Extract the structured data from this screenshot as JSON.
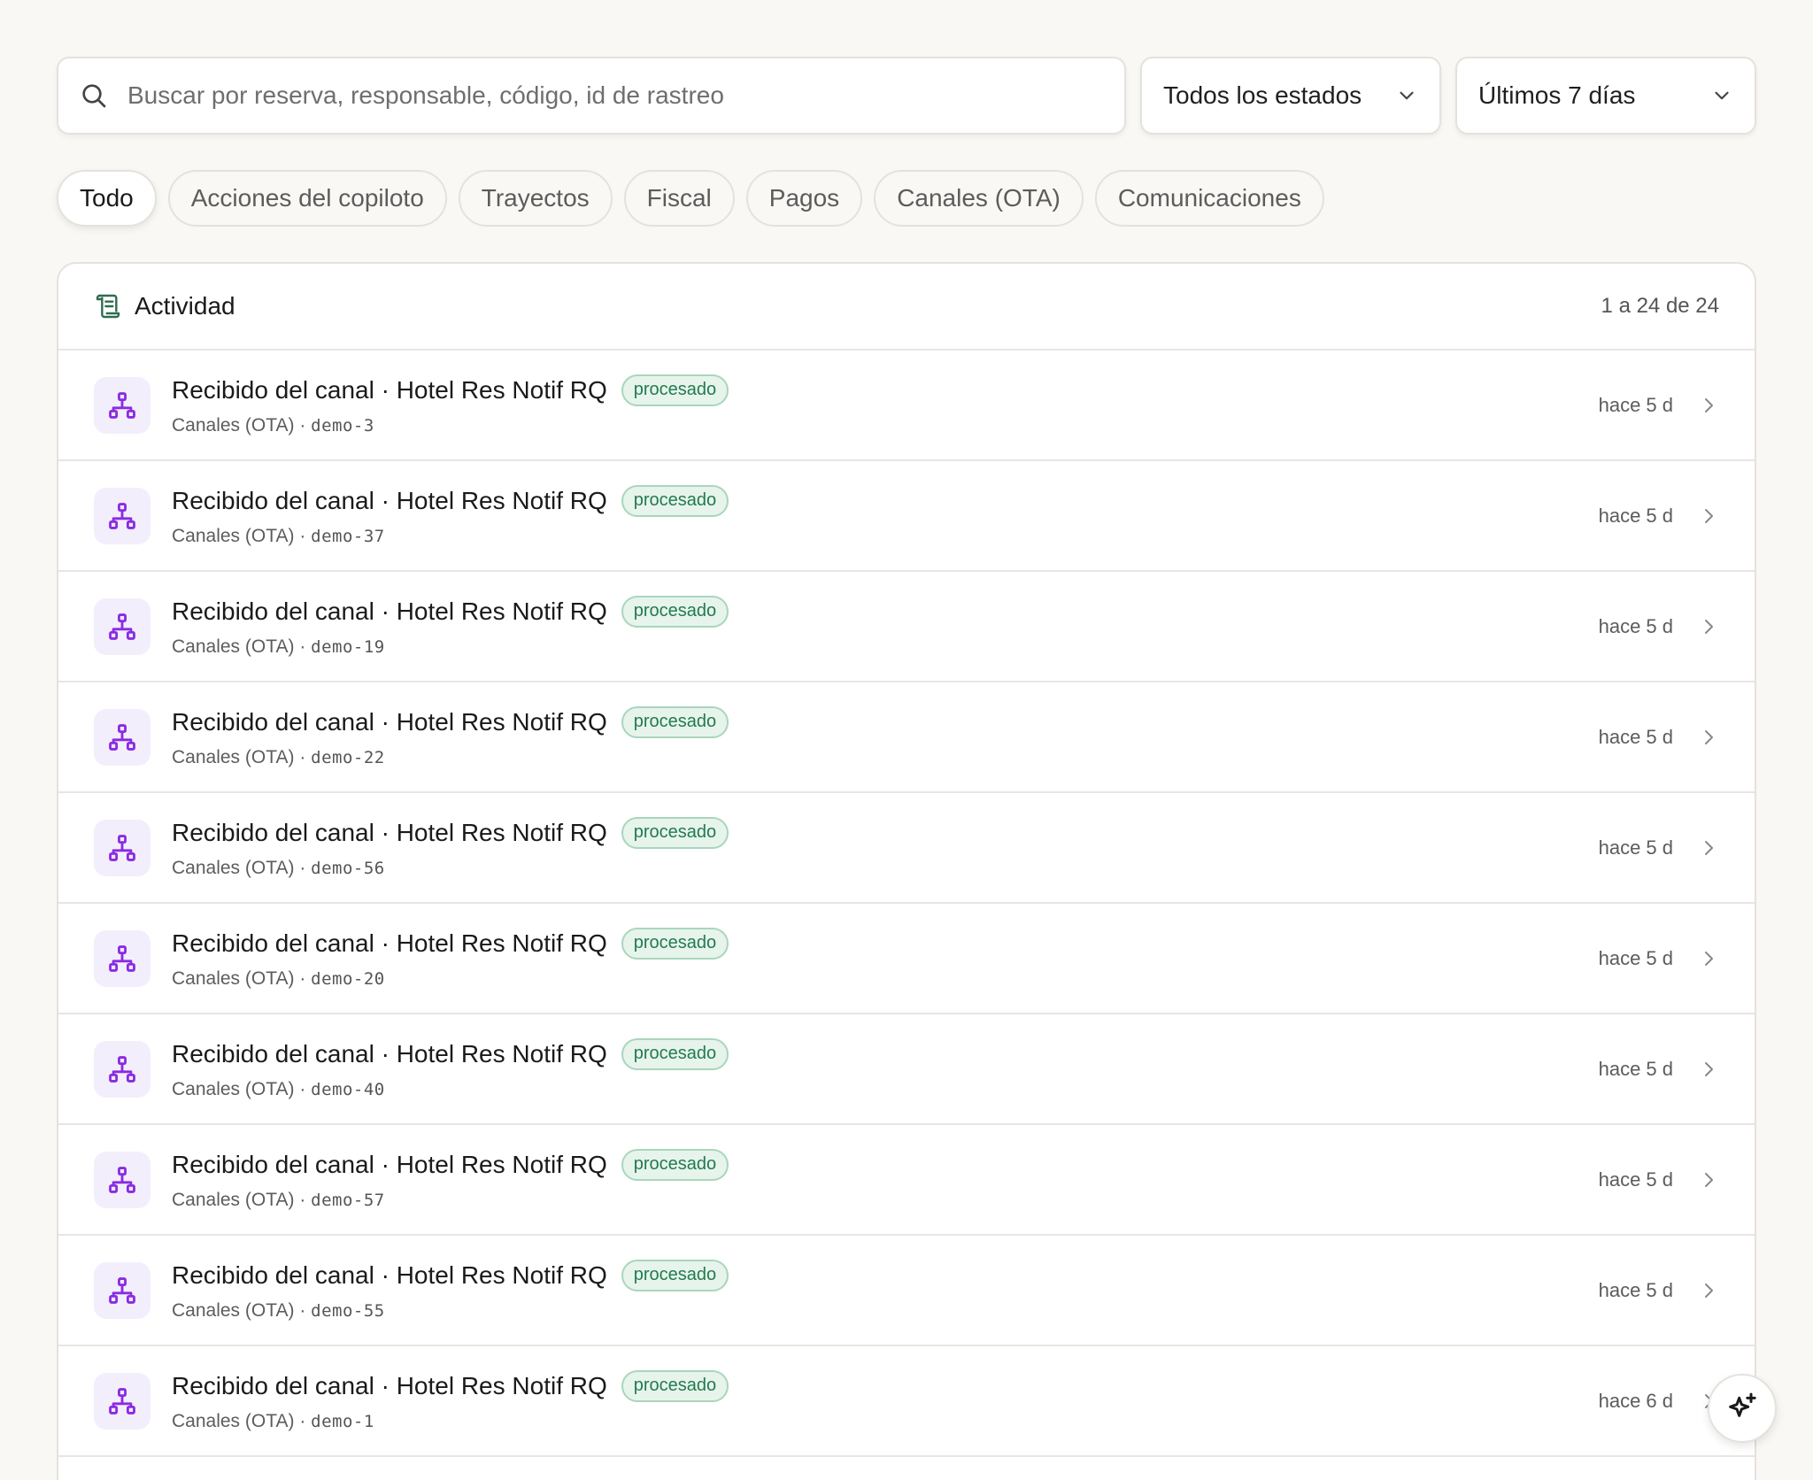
{
  "search": {
    "placeholder": "Buscar por reserva, responsable, código, id de rastreo",
    "value": ""
  },
  "filters": {
    "status_label": "Todos los estados",
    "range_label": "Últimos 7 días"
  },
  "chips": [
    {
      "label": "Todo",
      "active": true
    },
    {
      "label": "Acciones del copiloto",
      "active": false
    },
    {
      "label": "Trayectos",
      "active": false
    },
    {
      "label": "Fiscal",
      "active": false
    },
    {
      "label": "Pagos",
      "active": false
    },
    {
      "label": "Canales (OTA)",
      "active": false
    },
    {
      "label": "Comunicaciones",
      "active": false
    }
  ],
  "activity": {
    "title": "Actividad",
    "count": "1 a 24 de 24",
    "rows": [
      {
        "title": "Recibido del canal · Hotel Res Notif RQ",
        "badge": "procesado",
        "category": "Canales (OTA)",
        "separator": " · ",
        "code": "demo-3",
        "time": "hace 5 d"
      },
      {
        "title": "Recibido del canal · Hotel Res Notif RQ",
        "badge": "procesado",
        "category": "Canales (OTA)",
        "separator": " · ",
        "code": "demo-37",
        "time": "hace 5 d"
      },
      {
        "title": "Recibido del canal · Hotel Res Notif RQ",
        "badge": "procesado",
        "category": "Canales (OTA)",
        "separator": " · ",
        "code": "demo-19",
        "time": "hace 5 d"
      },
      {
        "title": "Recibido del canal · Hotel Res Notif RQ",
        "badge": "procesado",
        "category": "Canales (OTA)",
        "separator": " · ",
        "code": "demo-22",
        "time": "hace 5 d"
      },
      {
        "title": "Recibido del canal · Hotel Res Notif RQ",
        "badge": "procesado",
        "category": "Canales (OTA)",
        "separator": " · ",
        "code": "demo-56",
        "time": "hace 5 d"
      },
      {
        "title": "Recibido del canal · Hotel Res Notif RQ",
        "badge": "procesado",
        "category": "Canales (OTA)",
        "separator": " · ",
        "code": "demo-20",
        "time": "hace 5 d"
      },
      {
        "title": "Recibido del canal · Hotel Res Notif RQ",
        "badge": "procesado",
        "category": "Canales (OTA)",
        "separator": " · ",
        "code": "demo-40",
        "time": "hace 5 d"
      },
      {
        "title": "Recibido del canal · Hotel Res Notif RQ",
        "badge": "procesado",
        "category": "Canales (OTA)",
        "separator": " · ",
        "code": "demo-57",
        "time": "hace 5 d"
      },
      {
        "title": "Recibido del canal · Hotel Res Notif RQ",
        "badge": "procesado",
        "category": "Canales (OTA)",
        "separator": " · ",
        "code": "demo-55",
        "time": "hace 5 d"
      },
      {
        "title": "Recibido del canal · Hotel Res Notif RQ",
        "badge": "procesado",
        "category": "Canales (OTA)",
        "separator": " · ",
        "code": "demo-1",
        "time": "hace 6 d"
      }
    ]
  },
  "icons": {
    "search": "search-icon",
    "chevron": "chevron-down-icon",
    "activity": "scroll-list-icon",
    "row": "network-icon",
    "row_arrow": "chevron-right-icon",
    "fab": "sparkle-icon"
  },
  "colors": {
    "background": "#f9f8f5",
    "accent_purple": "#8a2be2",
    "badge_green": "#237a4e",
    "activity_icon": "#2f6b4f"
  }
}
